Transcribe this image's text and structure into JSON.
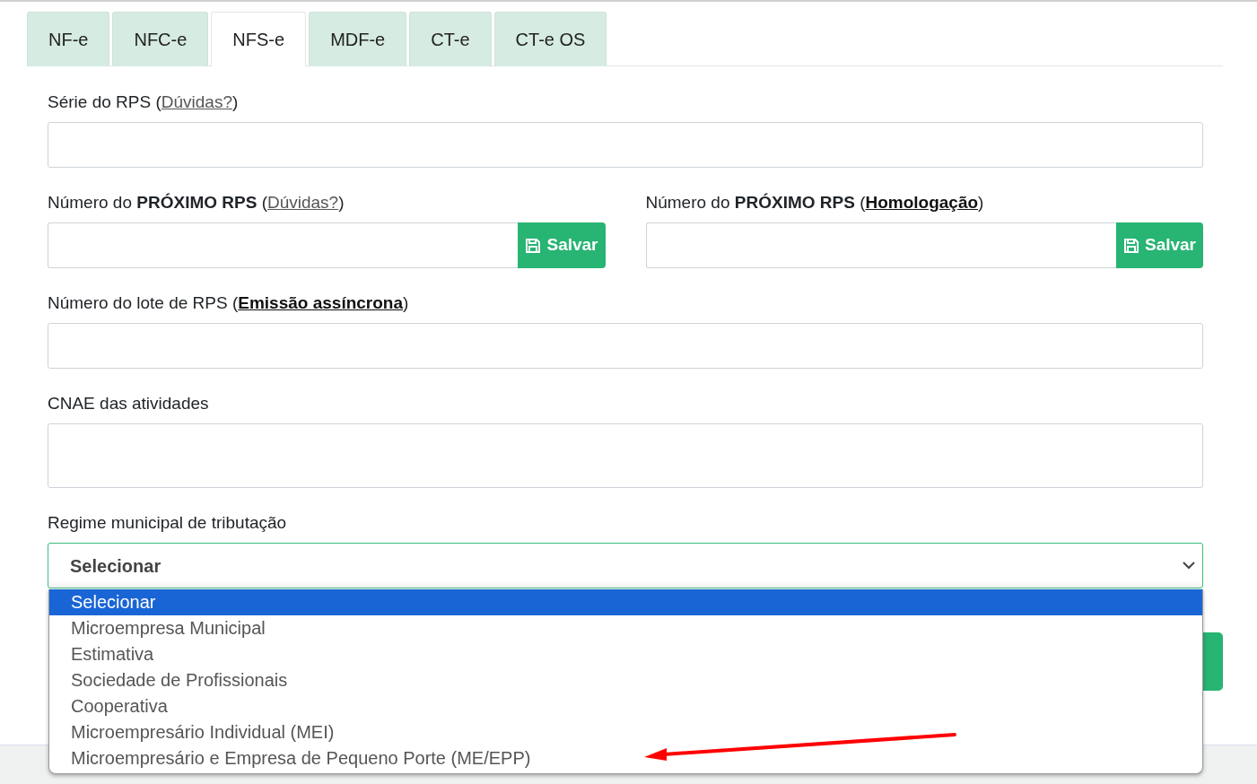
{
  "tabs": [
    {
      "label": "NF-e",
      "selected": false
    },
    {
      "label": "NFC-e",
      "selected": false
    },
    {
      "label": "NFS-e",
      "selected": true
    },
    {
      "label": "MDF-e",
      "selected": false
    },
    {
      "label": "CT-e",
      "selected": false
    },
    {
      "label": "CT-e OS",
      "selected": false
    }
  ],
  "fields": [
    {
      "kind": "text",
      "label": {
        "text": "Série do RPS (",
        "link": "Dúvidas?",
        "link_strong": false,
        "suffix": ")"
      }
    },
    {
      "kind": "pair",
      "items": [
        {
          "label": {
            "text": "Número do **PRÓXIMO RPS** (",
            "link": "Dúvidas?",
            "link_strong": false,
            "suffix": ")"
          },
          "button": "Salvar"
        },
        {
          "label": {
            "text": "Número do **PRÓXIMO RPS** (",
            "link": "Homologação",
            "link_strong": true,
            "suffix": ")"
          },
          "button": "Salvar"
        }
      ]
    },
    {
      "kind": "text",
      "label": {
        "text": "Número do lote de RPS (",
        "link": "Emissão assíncrona",
        "link_strong": true,
        "suffix": ")"
      }
    },
    {
      "kind": "textarea",
      "label": {
        "text": "CNAE das atividades"
      }
    },
    {
      "kind": "select",
      "label": {
        "text": "Regime municipal de tributação"
      },
      "value": "Selecionar",
      "expanded": true,
      "options": [
        {
          "label": "Selecionar",
          "selected": true
        },
        {
          "label": "Microempresa Municipal",
          "selected": false
        },
        {
          "label": "Estimativa",
          "selected": false
        },
        {
          "label": "Sociedade de Profissionais",
          "selected": false
        },
        {
          "label": "Cooperativa",
          "selected": false
        },
        {
          "label": "Microempresário Individual (MEI)",
          "selected": false
        },
        {
          "label": "Microempresário e Empresa de Pequeno Porte (ME/EPP)",
          "selected": false
        }
      ]
    }
  ]
}
